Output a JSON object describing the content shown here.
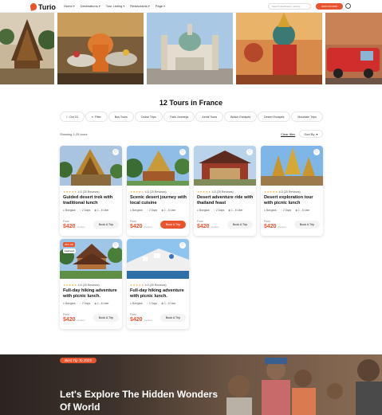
{
  "header": {
    "logo": "Turio",
    "nav": [
      "Home",
      "Destinations",
      "Tour Listing",
      "Restaurants",
      "Page"
    ],
    "search_placeholder": "Search destination, activity",
    "phone": "0000 000 0000",
    "user_icon": "user-icon"
  },
  "hero": {
    "tiles": [
      "temple",
      "monk-offerings",
      "church",
      "golden-statue",
      "red-truck"
    ]
  },
  "listing": {
    "title": "12 Tours in France",
    "filters": [
      "Oct 23",
      "Filter",
      "Bus Tours",
      "Cruise Trips",
      "Train Journeys",
      "Aerial Tours",
      "Beach Escapes",
      "Desert Escapes",
      "Mountain Trips"
    ],
    "showing": "Showing 1-25 tours",
    "clear": "Clear filter",
    "sort_label": "Sort By"
  },
  "cards": [
    {
      "rating": "4.5 (25 Reviews)",
      "title": "Guided desert trek with traditional lunch",
      "location": "Bangkok",
      "days": "2 Days",
      "users": "1 - 6 User",
      "from": "From",
      "price": "$420",
      "per": "/person",
      "book": "Book A Trip",
      "active": false,
      "featured": "",
      "discount": ""
    },
    {
      "rating": "4.5 (25 Reviews)",
      "title": "Scenic desert journey with local cuisine",
      "location": "Bangkok",
      "days": "2 Days",
      "users": "1 - 6 User",
      "from": "From",
      "price": "$420",
      "per": "/person",
      "book": "Book A Trip",
      "active": true,
      "featured": "",
      "discount": ""
    },
    {
      "rating": "4.5 (25 Reviews)",
      "title": "Desert adventure ride with thailand feast",
      "location": "Bangkok",
      "days": "2 Days",
      "users": "1 - 6 User",
      "from": "From",
      "price": "$420",
      "per": "/person",
      "book": "Book A Trip",
      "active": false,
      "featured": "",
      "discount": ""
    },
    {
      "rating": "4.5 (25 Reviews)",
      "title": "Desert exploration tour with picnic lunch",
      "location": "Bangkok",
      "days": "2 Days",
      "users": "1 - 6 User",
      "from": "From",
      "price": "$420",
      "per": "/person",
      "book": "Book A Trip",
      "active": false,
      "featured": "",
      "discount": ""
    },
    {
      "rating": "4.5 (25 Reviews)",
      "title": "Full-day hiking adventure with picnic lunch.",
      "location": "Bangkok",
      "days": "2 Days",
      "users": "1 - 6 User",
      "from": "From",
      "price": "$420",
      "per": "/person",
      "book": "Book A Trip",
      "active": false,
      "featured": "Featured",
      "discount": "25% Off"
    },
    {
      "rating": "4.5 (25 Reviews)",
      "title": "Full-day hiking adventure with picnic lunch.",
      "location": "Bangkok",
      "days": "2 Days",
      "users": "1 - 6 User",
      "from": "From",
      "price": "$420",
      "per": "/person",
      "book": "Book A Trip",
      "active": false,
      "featured": "",
      "discount": ""
    }
  ],
  "promo": {
    "tag": "Best Tip To 2025",
    "heading": "Let's Explore The Hidden Wonders Of World"
  }
}
